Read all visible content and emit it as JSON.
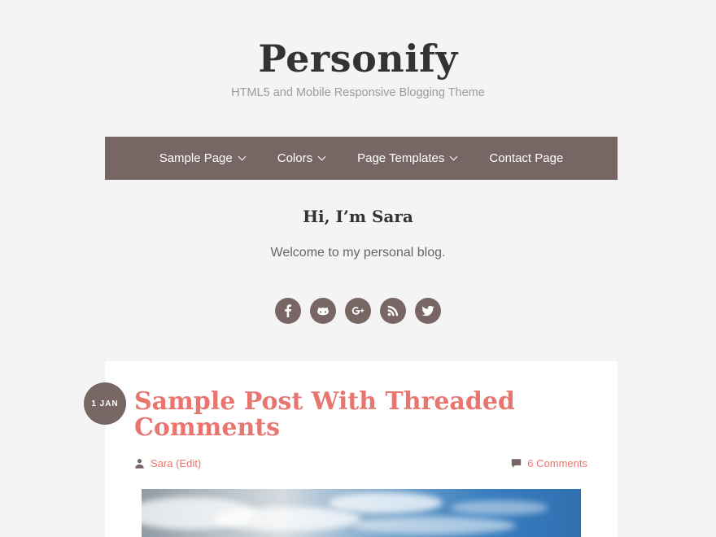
{
  "site": {
    "title": "Personify",
    "tagline": "HTML5 and Mobile Responsive Blogging Theme"
  },
  "nav": {
    "items": [
      {
        "label": "Sample Page",
        "has_dropdown": true
      },
      {
        "label": "Colors",
        "has_dropdown": true
      },
      {
        "label": "Page Templates",
        "has_dropdown": true
      },
      {
        "label": "Contact Page",
        "has_dropdown": false
      }
    ]
  },
  "intro": {
    "title": "Hi, I’m Sara",
    "text": "Welcome to my personal blog."
  },
  "social": [
    "facebook-icon",
    "github-icon",
    "google-plus-icon",
    "rss-icon",
    "twitter-icon"
  ],
  "post": {
    "date": "1 JAN",
    "title": "Sample Post With Threaded Comments",
    "author": "Sara",
    "edit": "(Edit)",
    "comments": "6 Comments"
  },
  "colors": {
    "accent": "#e8766f",
    "nav_bg": "#786665",
    "page_bg": "#f4f4f4"
  }
}
